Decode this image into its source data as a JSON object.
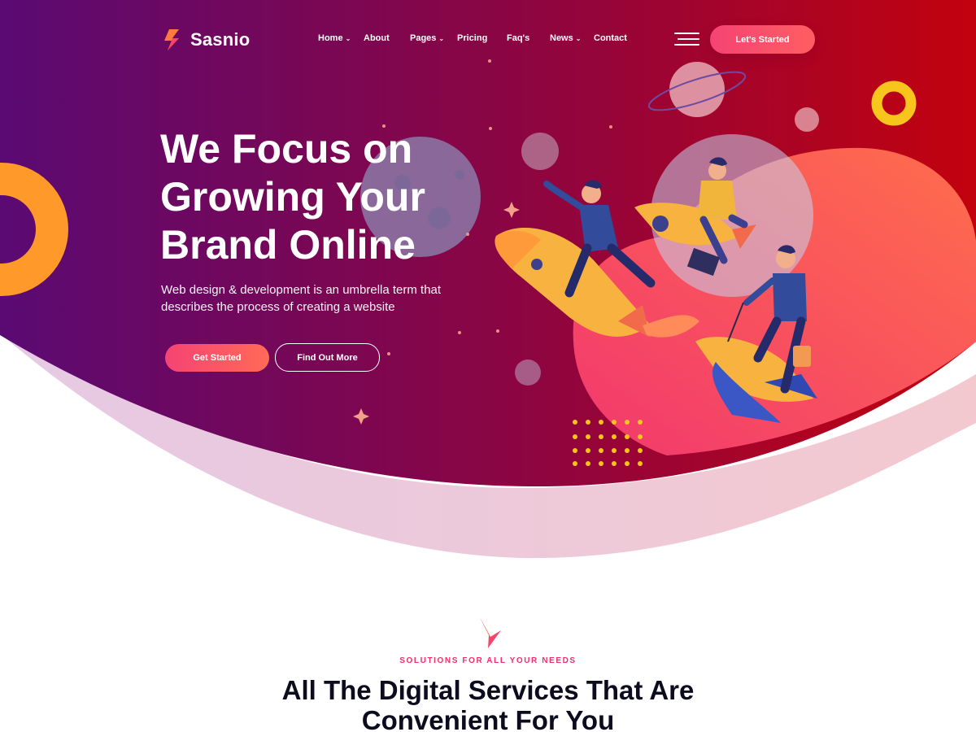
{
  "brand": {
    "name": "Sasnio"
  },
  "nav": {
    "items": [
      {
        "label": "Home",
        "has_dropdown": true
      },
      {
        "label": "About",
        "has_dropdown": false
      },
      {
        "label": "Pages",
        "has_dropdown": true
      },
      {
        "label": "Pricing",
        "has_dropdown": false
      },
      {
        "label": "Faq's",
        "has_dropdown": false
      },
      {
        "label": "News",
        "has_dropdown": true
      },
      {
        "label": "Contact",
        "has_dropdown": false
      }
    ],
    "cta_label": "Let's Started",
    "dropdown_glyph": "⌄"
  },
  "hero": {
    "title_lines": [
      "We Focus on",
      "Growing Your",
      "Brand Online"
    ],
    "subtitle": "Web design & development is an umbrella term that describes the process of creating a website",
    "primary_label": "Get Started",
    "secondary_label": "Find Out More",
    "illustration": "rocket-riders-illustration"
  },
  "section": {
    "eyebrow": "SOLUTIONS FOR ALL YOUR NEEDS",
    "title_lines": [
      "All The Digital Services That Are",
      "Convenient For You"
    ],
    "icon": "arrow-mark-icon"
  },
  "colors": {
    "hero_start": "#5a0a73",
    "hero_mid": "#8e0540",
    "hero_end": "#c2020e",
    "accent_pink": "#f54374",
    "accent_coral": "#ff5e62",
    "accent_orange": "#ff9a2a",
    "accent_yellow": "#f8c51c",
    "heading_dark": "#0c0c1e"
  }
}
